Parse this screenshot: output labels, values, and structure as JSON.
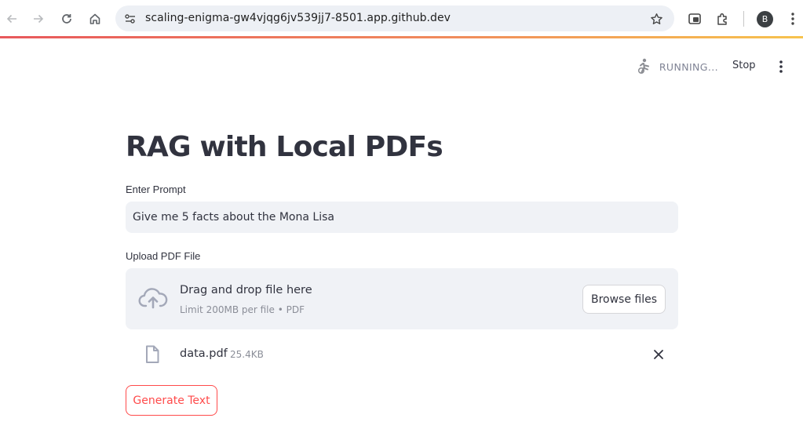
{
  "browser": {
    "url": "scaling-enigma-gw4vjqg6jv539jj7-8501.app.github.dev",
    "profile_initial": "B"
  },
  "app_header": {
    "status": "RUNNING...",
    "stop_label": "Stop"
  },
  "main": {
    "title": "RAG with Local PDFs",
    "prompt": {
      "label": "Enter Prompt",
      "value": "Give me 5 facts about the Mona Lisa"
    },
    "upload": {
      "label": "Upload PDF File",
      "drop_title": "Drag and drop file here",
      "drop_subtitle": "Limit 200MB per file • PDF",
      "browse_label": "Browse files"
    },
    "file": {
      "name": "data.pdf",
      "size": "25.4KB"
    },
    "generate_label": "Generate Text"
  },
  "colors": {
    "accent": "#ff4b4b",
    "text": "#31333f",
    "input_bg": "#f0f2f6"
  }
}
